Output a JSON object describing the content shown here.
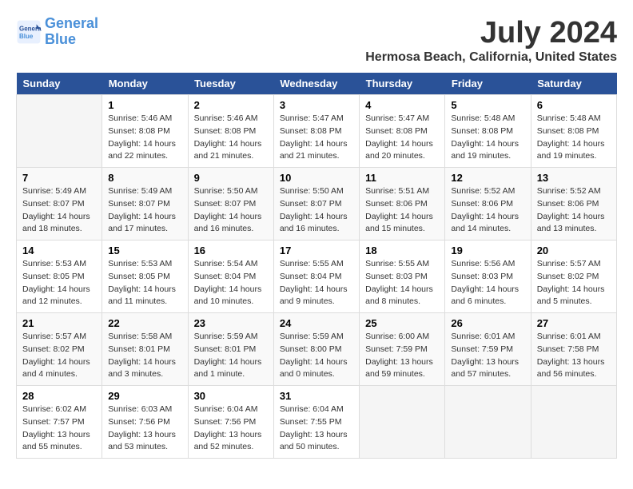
{
  "header": {
    "logo_line1": "General",
    "logo_line2": "Blue",
    "title": "July 2024",
    "subtitle": "Hermosa Beach, California, United States"
  },
  "weekdays": [
    "Sunday",
    "Monday",
    "Tuesday",
    "Wednesday",
    "Thursday",
    "Friday",
    "Saturday"
  ],
  "weeks": [
    [
      {
        "day": "",
        "info": ""
      },
      {
        "day": "1",
        "info": "Sunrise: 5:46 AM\nSunset: 8:08 PM\nDaylight: 14 hours\nand 22 minutes."
      },
      {
        "day": "2",
        "info": "Sunrise: 5:46 AM\nSunset: 8:08 PM\nDaylight: 14 hours\nand 21 minutes."
      },
      {
        "day": "3",
        "info": "Sunrise: 5:47 AM\nSunset: 8:08 PM\nDaylight: 14 hours\nand 21 minutes."
      },
      {
        "day": "4",
        "info": "Sunrise: 5:47 AM\nSunset: 8:08 PM\nDaylight: 14 hours\nand 20 minutes."
      },
      {
        "day": "5",
        "info": "Sunrise: 5:48 AM\nSunset: 8:08 PM\nDaylight: 14 hours\nand 19 minutes."
      },
      {
        "day": "6",
        "info": "Sunrise: 5:48 AM\nSunset: 8:08 PM\nDaylight: 14 hours\nand 19 minutes."
      }
    ],
    [
      {
        "day": "7",
        "info": "Sunrise: 5:49 AM\nSunset: 8:07 PM\nDaylight: 14 hours\nand 18 minutes."
      },
      {
        "day": "8",
        "info": "Sunrise: 5:49 AM\nSunset: 8:07 PM\nDaylight: 14 hours\nand 17 minutes."
      },
      {
        "day": "9",
        "info": "Sunrise: 5:50 AM\nSunset: 8:07 PM\nDaylight: 14 hours\nand 16 minutes."
      },
      {
        "day": "10",
        "info": "Sunrise: 5:50 AM\nSunset: 8:07 PM\nDaylight: 14 hours\nand 16 minutes."
      },
      {
        "day": "11",
        "info": "Sunrise: 5:51 AM\nSunset: 8:06 PM\nDaylight: 14 hours\nand 15 minutes."
      },
      {
        "day": "12",
        "info": "Sunrise: 5:52 AM\nSunset: 8:06 PM\nDaylight: 14 hours\nand 14 minutes."
      },
      {
        "day": "13",
        "info": "Sunrise: 5:52 AM\nSunset: 8:06 PM\nDaylight: 14 hours\nand 13 minutes."
      }
    ],
    [
      {
        "day": "14",
        "info": "Sunrise: 5:53 AM\nSunset: 8:05 PM\nDaylight: 14 hours\nand 12 minutes."
      },
      {
        "day": "15",
        "info": "Sunrise: 5:53 AM\nSunset: 8:05 PM\nDaylight: 14 hours\nand 11 minutes."
      },
      {
        "day": "16",
        "info": "Sunrise: 5:54 AM\nSunset: 8:04 PM\nDaylight: 14 hours\nand 10 minutes."
      },
      {
        "day": "17",
        "info": "Sunrise: 5:55 AM\nSunset: 8:04 PM\nDaylight: 14 hours\nand 9 minutes."
      },
      {
        "day": "18",
        "info": "Sunrise: 5:55 AM\nSunset: 8:03 PM\nDaylight: 14 hours\nand 8 minutes."
      },
      {
        "day": "19",
        "info": "Sunrise: 5:56 AM\nSunset: 8:03 PM\nDaylight: 14 hours\nand 6 minutes."
      },
      {
        "day": "20",
        "info": "Sunrise: 5:57 AM\nSunset: 8:02 PM\nDaylight: 14 hours\nand 5 minutes."
      }
    ],
    [
      {
        "day": "21",
        "info": "Sunrise: 5:57 AM\nSunset: 8:02 PM\nDaylight: 14 hours\nand 4 minutes."
      },
      {
        "day": "22",
        "info": "Sunrise: 5:58 AM\nSunset: 8:01 PM\nDaylight: 14 hours\nand 3 minutes."
      },
      {
        "day": "23",
        "info": "Sunrise: 5:59 AM\nSunset: 8:01 PM\nDaylight: 14 hours\nand 1 minute."
      },
      {
        "day": "24",
        "info": "Sunrise: 5:59 AM\nSunset: 8:00 PM\nDaylight: 14 hours\nand 0 minutes."
      },
      {
        "day": "25",
        "info": "Sunrise: 6:00 AM\nSunset: 7:59 PM\nDaylight: 13 hours\nand 59 minutes."
      },
      {
        "day": "26",
        "info": "Sunrise: 6:01 AM\nSunset: 7:59 PM\nDaylight: 13 hours\nand 57 minutes."
      },
      {
        "day": "27",
        "info": "Sunrise: 6:01 AM\nSunset: 7:58 PM\nDaylight: 13 hours\nand 56 minutes."
      }
    ],
    [
      {
        "day": "28",
        "info": "Sunrise: 6:02 AM\nSunset: 7:57 PM\nDaylight: 13 hours\nand 55 minutes."
      },
      {
        "day": "29",
        "info": "Sunrise: 6:03 AM\nSunset: 7:56 PM\nDaylight: 13 hours\nand 53 minutes."
      },
      {
        "day": "30",
        "info": "Sunrise: 6:04 AM\nSunset: 7:56 PM\nDaylight: 13 hours\nand 52 minutes."
      },
      {
        "day": "31",
        "info": "Sunrise: 6:04 AM\nSunset: 7:55 PM\nDaylight: 13 hours\nand 50 minutes."
      },
      {
        "day": "",
        "info": ""
      },
      {
        "day": "",
        "info": ""
      },
      {
        "day": "",
        "info": ""
      }
    ]
  ]
}
